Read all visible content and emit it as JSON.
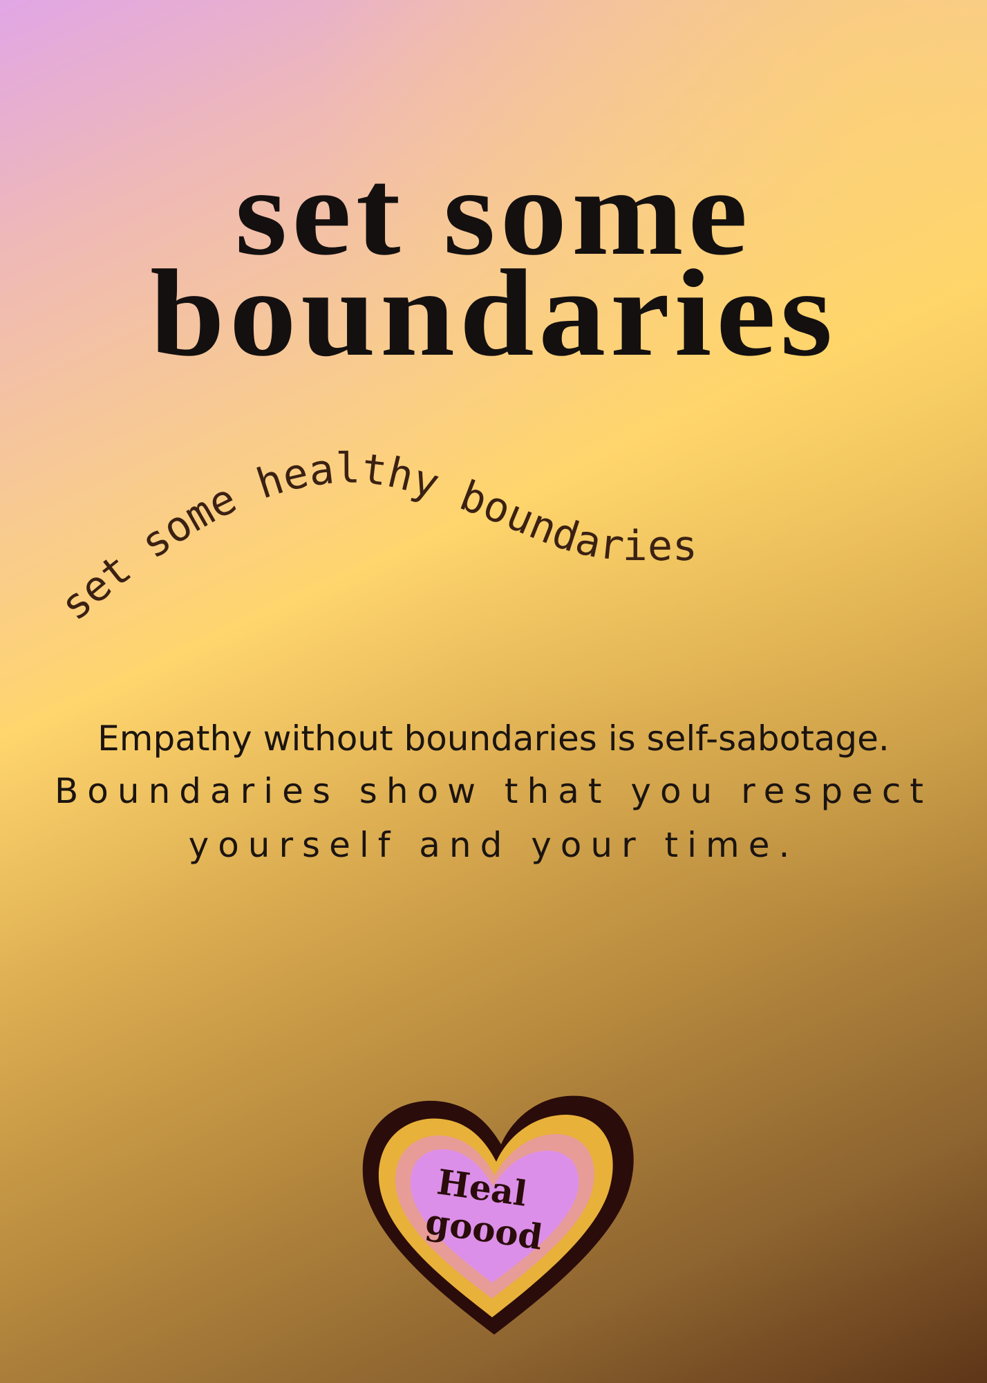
{
  "poster": {
    "title_line1": "set some",
    "title_line2": "boundaries",
    "arc_text": "set some healthy boundaries",
    "body_line1": "Empathy without boundaries is self-sabotage.",
    "body_line2": "Boundaries show that you respect",
    "body_line3": "yourself and your time."
  },
  "badge": {
    "word1": "Heal",
    "word2": "goood",
    "icon": "heart-icon"
  },
  "colors": {
    "text_dark": "#141010",
    "arc_text": "#3b2113",
    "heart_outline": "#2a0c0a",
    "heart_yellow": "#e8b13a",
    "heart_pink": "#e79c98",
    "heart_lavender": "#dc8fe9"
  }
}
